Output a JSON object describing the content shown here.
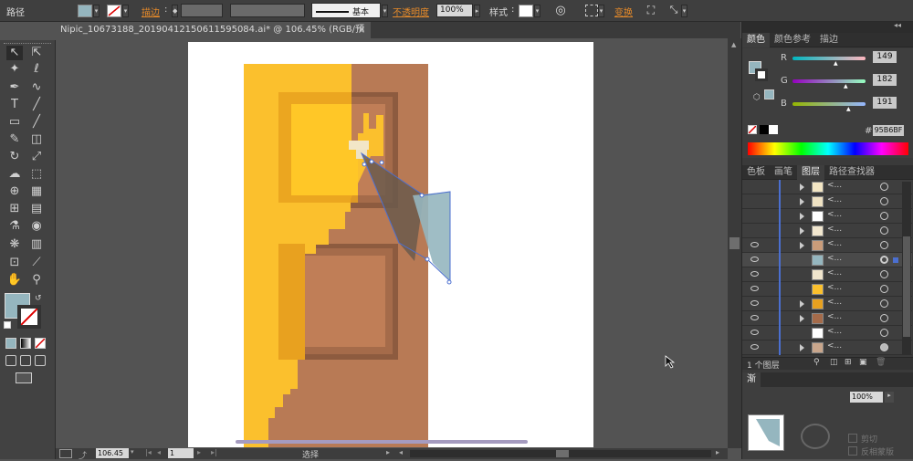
{
  "control_bar": {
    "object_type": "路径",
    "stroke_label": "描边",
    "stroke_style": "基本",
    "opacity_label": "不透明度",
    "opacity_value": "100%",
    "style_label": "样式",
    "transform_label": "变换",
    "fill_color": "#95B6BF"
  },
  "document": {
    "tab_title": "Nipic_10673188_20190412150611595084.ai* @ 106.45% (RGB/预览)",
    "close": "×"
  },
  "status_bar": {
    "zoom": "106.45",
    "page": "1",
    "status_text": "选择"
  },
  "color_panel": {
    "tabs": [
      "颜色",
      "颜色参考",
      "描边"
    ],
    "channels": [
      {
        "label": "R",
        "value": "149"
      },
      {
        "label": "G",
        "value": "182"
      },
      {
        "label": "B",
        "value": "191"
      }
    ],
    "hex_label": "#",
    "hex": "95B6BF"
  },
  "layers_panel": {
    "tabs": [
      "色板",
      "画笔",
      "图层",
      "路径查找器"
    ],
    "row_label": "<...",
    "footer_count": "1 个图层"
  },
  "lower_panel": {
    "tab": "渐",
    "opacity_value": "100%",
    "clip_label": "剪切",
    "invert_label": "反相蒙版"
  },
  "colors": {
    "accent": "#95B6BF",
    "door_brown": "#B87A55",
    "door_yellow": "#FBC02D",
    "selection": "#4b6fd0",
    "orange_label": "#e58a2a"
  },
  "icons": [
    "selection-tool-icon",
    "direct-selection-icon",
    "magic-wand-icon",
    "lasso-icon",
    "pen-tool-icon",
    "curvature-icon",
    "type-tool-icon",
    "line-tool-icon",
    "rectangle-tool-icon",
    "paintbrush-icon",
    "pencil-icon",
    "eraser-icon",
    "rotate-icon",
    "scale-icon",
    "warp-icon",
    "free-transform-icon",
    "shape-builder-icon",
    "perspective-icon",
    "mesh-icon",
    "gradient-icon",
    "eyedropper-icon",
    "blend-icon",
    "symbol-sprayer-icon",
    "graph-icon",
    "artboard-icon",
    "slice-icon",
    "hand-icon",
    "zoom-icon"
  ]
}
